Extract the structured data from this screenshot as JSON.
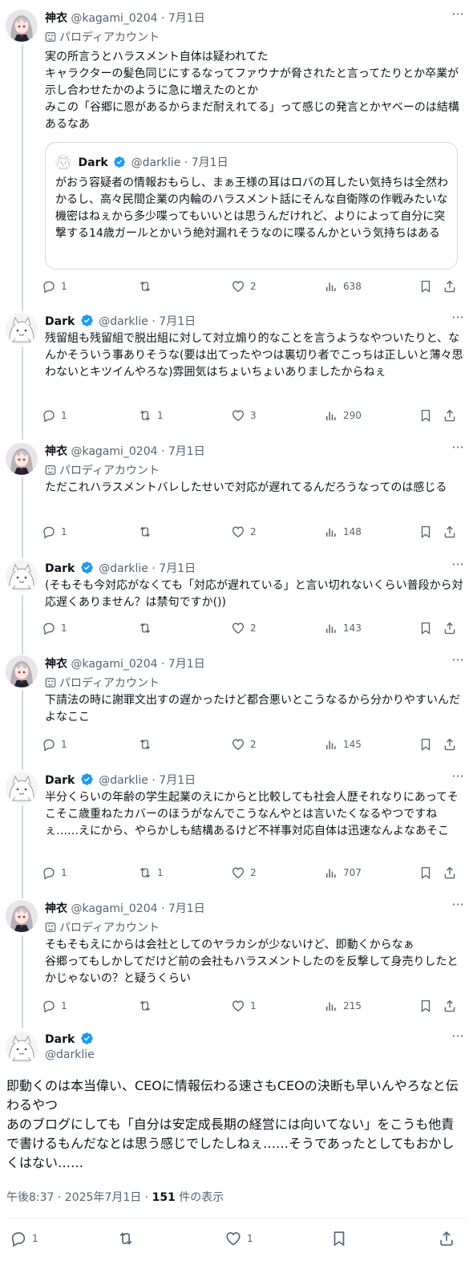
{
  "parody_label": "パロディアカウント",
  "tweets": [
    {
      "name": "神衣",
      "handle": "@kagami_0204",
      "sep": "·",
      "date": "7月1日",
      "text": "実の所言うとハラスメント自体は疑われてた\nキャラクターの髪色同じにするなってファウナが脅されたと言ってたりとか卒業が示し合わせたかのように急に増えたのとか\nみこの「谷郷に恩があるからまだ耐えれてる」って感じの発言とかヤベーのは結構あるなあ",
      "quote": {
        "name": "Dark",
        "handle": "@darklie",
        "sep": "·",
        "date": "7月1日",
        "text": "がおう容疑者の情報おもらし、まぁ王様の耳はロバの耳したい気持ちは全然わかるし、高々民間企業の内輪のハラスメント話にそんな自衛隊の作戦みたいな機密はねぇから多少喋ってもいいとは思うんだけれど、よりによって自分に突撃する14歳ガールとかいう絶対漏れそうなのに喋るんかという気持ちはある"
      },
      "replies": "1",
      "retweets": "",
      "likes": "2",
      "views": "638"
    },
    {
      "name": "Dark",
      "handle": "@darklie",
      "sep": "·",
      "date": "7月1日",
      "text": "残留組も残留組で脱出組に対して対立煽り的なことを言うようなやついたりと、なんかそういう事ありそうな(要は出てったやつは裏切り者でこっちは正しいと薄々思わないとキツイんやろな)雰囲気はちょいちょいありましたからねぇ",
      "replies": "1",
      "retweets": "1",
      "likes": "3",
      "views": "290"
    },
    {
      "name": "神衣",
      "handle": "@kagami_0204",
      "sep": "·",
      "date": "7月1日",
      "text": "ただこれハラスメントバレしたせいで対応が遅れてるんだろうなってのは感じる",
      "replies": "1",
      "retweets": "",
      "likes": "2",
      "views": "148"
    },
    {
      "name": "Dark",
      "handle": "@darklie",
      "sep": "·",
      "date": "7月1日",
      "text": "(そもそも今対応がなくても「対応が遅れている」と言い切れないくらい普段から対応遅くありません？は禁句ですか())",
      "replies": "1",
      "retweets": "",
      "likes": "2",
      "views": "143"
    },
    {
      "name": "神衣",
      "handle": "@kagami_0204",
      "sep": "·",
      "date": "7月1日",
      "text": "下請法の時に謝罪文出すの遅かったけど都合悪いとこうなるから分かりやすいんだよなここ",
      "replies": "1",
      "retweets": "",
      "likes": "2",
      "views": "145"
    },
    {
      "name": "Dark",
      "handle": "@darklie",
      "sep": "·",
      "date": "7月1日",
      "text": "半分くらいの年齢の学生起業のえにからと比較しても社会人歴それなりにあってそこそこ歳重ねたカバーのほうがなんでこうなんやとは言いたくなるやつですねぇ……えにから、やらかしも結構あるけど不祥事対応自体は迅速なんよなあそこ",
      "replies": "1",
      "retweets": "1",
      "likes": "2",
      "views": "707"
    },
    {
      "name": "神衣",
      "handle": "@kagami_0204",
      "sep": "·",
      "date": "7月1日",
      "text": "そもそもえにからは会社としてのヤラカシが少ないけど、即動くからなぁ\n谷郷ってもしかしてだけど前の会社もハラスメントしたのを反撃して身売りしたとかじゃないの？と疑うくらい",
      "replies": "1",
      "retweets": "",
      "likes": "1",
      "views": "215"
    }
  ],
  "main": {
    "name": "Dark",
    "handle": "@darklie",
    "text": "即動くのは本当偉い、CEOに情報伝わる速さもCEOの決断も早いんやろなと伝わるやつ\nあのブログにしても「自分は安定成長期の経営には向いてない」をこうも他責で書けるもんだなとは思う感じでしたしねぇ……そうであったとしてもおかしくはない……",
    "time": "午後8:37 · 2025年7月1日 · ",
    "views": "151",
    "views_suffix": " 件の表示",
    "replies": "1",
    "retweets": "",
    "likes": "1"
  },
  "colors": {
    "verified": "#1d9bf0",
    "muted": "#536471",
    "line": "#cfd9de"
  }
}
